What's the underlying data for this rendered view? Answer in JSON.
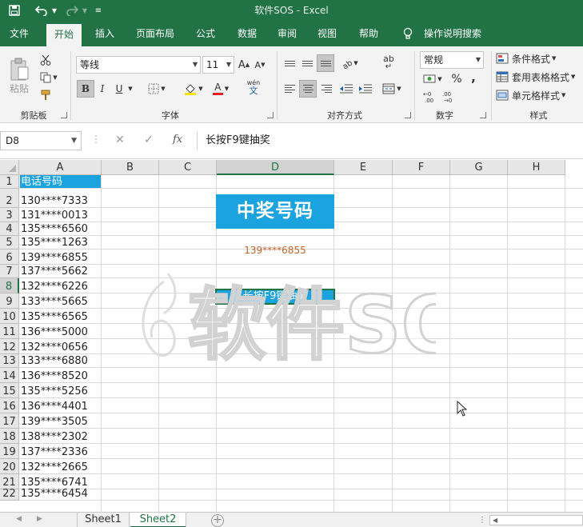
{
  "window": {
    "title": "软件SOS  -  Excel"
  },
  "ribbon_tabs": [
    {
      "label": "文件"
    },
    {
      "label": "开始"
    },
    {
      "label": "插入"
    },
    {
      "label": "页面布局"
    },
    {
      "label": "公式"
    },
    {
      "label": "数据"
    },
    {
      "label": "审阅"
    },
    {
      "label": "视图"
    },
    {
      "label": "帮助"
    },
    {
      "label": "操作说明搜索"
    }
  ],
  "ribbon": {
    "clipboard": {
      "paste": "粘贴",
      "label": "剪贴板"
    },
    "font": {
      "name": "等线",
      "size": "11",
      "bold": "B",
      "italic": "I",
      "underline": "U",
      "grow": "A",
      "shrink": "A",
      "color_a": "A",
      "wen": "wén",
      "wen2": "文",
      "label": "字体"
    },
    "alignment": {
      "wrap": "ab",
      "label": "对齐方式"
    },
    "number": {
      "format": "常规",
      "percent": "%",
      "comma": ",",
      "label": "数字"
    },
    "styles": {
      "conditional": "条件格式",
      "table": "套用表格格式",
      "cell": "单元格样式",
      "label": "样式"
    }
  },
  "formula_bar": {
    "name_box": "D8",
    "cancel": "✕",
    "enter": "✓",
    "fx": "fx",
    "content": "长按F9键抽奖"
  },
  "columns": [
    "A",
    "B",
    "C",
    "D",
    "E",
    "F",
    "G",
    "H"
  ],
  "rows": [
    "1",
    "2",
    "3",
    "4",
    "5",
    "6",
    "7",
    "8",
    "9",
    "10",
    "11",
    "12",
    "13",
    "14",
    "15",
    "16",
    "17",
    "18",
    "19",
    "20",
    "21",
    "22"
  ],
  "sheet": {
    "header": "电话号码",
    "phones": [
      "130****7333",
      "131****0013",
      "135****6560",
      "135****1263",
      "139****6855",
      "137****5662",
      "132****6226",
      "133****5665",
      "135****6565",
      "136****5000",
      "132****0656",
      "133****6880",
      "136****8520",
      "135****5256",
      "136****4401",
      "139****3505",
      "138****2302",
      "137****2336",
      "132****2665",
      "135****6741",
      "135****6454"
    ],
    "prize_title": "中奖号码",
    "prize_number": "139****6855",
    "draw_button": "长按F9键抽奖"
  },
  "watermark": "软件SOS",
  "sheet_tabs": [
    {
      "label": "Sheet1"
    },
    {
      "label": "Sheet2"
    }
  ],
  "colors": {
    "excel_green": "#217346",
    "accent_blue": "#1aa3df",
    "prize_number": "#c0622a"
  }
}
